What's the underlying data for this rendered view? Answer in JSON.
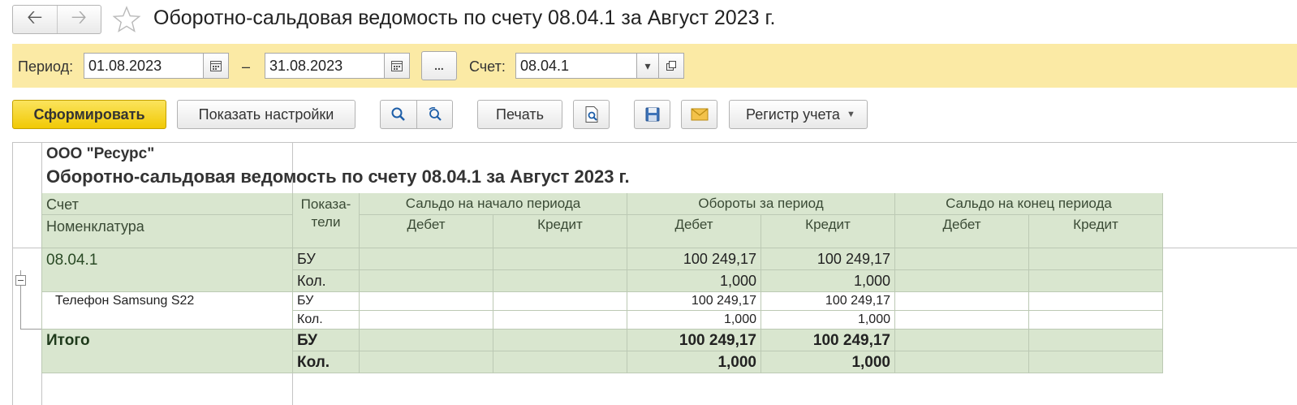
{
  "window": {
    "title": "Оборотно-сальдовая ведомость по счету 08.04.1 за Август 2023 г."
  },
  "filter": {
    "period_label": "Период:",
    "date_from": "01.08.2023",
    "dash": "–",
    "date_to": "31.08.2023",
    "more_label": "...",
    "account_label": "Счет:",
    "account_value": "08.04.1"
  },
  "toolbar": {
    "generate_label": "Сформировать",
    "settings_label": "Показать настройки",
    "print_label": "Печать",
    "register_label": "Регистр учета"
  },
  "report": {
    "company": "ООО \"Ресурс\"",
    "title": "Оборотно-сальдовая ведомость по счету 08.04.1 за Август 2023 г.",
    "headers": {
      "account": "Счет",
      "nomenclature": "Номенклатура",
      "indicators": "Показа-\nтели",
      "opening_balance": "Сальдо на начало периода",
      "turnover": "Обороты за период",
      "closing_balance": "Сальдо на конец периода",
      "debit": "Дебет",
      "credit": "Кредит"
    },
    "rows": [
      {
        "name": "08.04.1",
        "indicator": "БУ",
        "turnover_debit": "100 249,17",
        "turnover_credit": "100 249,17"
      },
      {
        "name": "",
        "indicator": "Кол.",
        "turnover_debit": "1,000",
        "turnover_credit": "1,000"
      },
      {
        "name": "Телефон Samsung S22",
        "indicator": "БУ",
        "turnover_debit": "100 249,17",
        "turnover_credit": "100 249,17"
      },
      {
        "name": "",
        "indicator": "Кол.",
        "turnover_debit": "1,000",
        "turnover_credit": "1,000"
      },
      {
        "name": "Итого",
        "indicator": "БУ",
        "turnover_debit": "100 249,17",
        "turnover_credit": "100 249,17"
      },
      {
        "name": "",
        "indicator": "Кол.",
        "turnover_debit": "1,000",
        "turnover_credit": "1,000"
      }
    ]
  }
}
